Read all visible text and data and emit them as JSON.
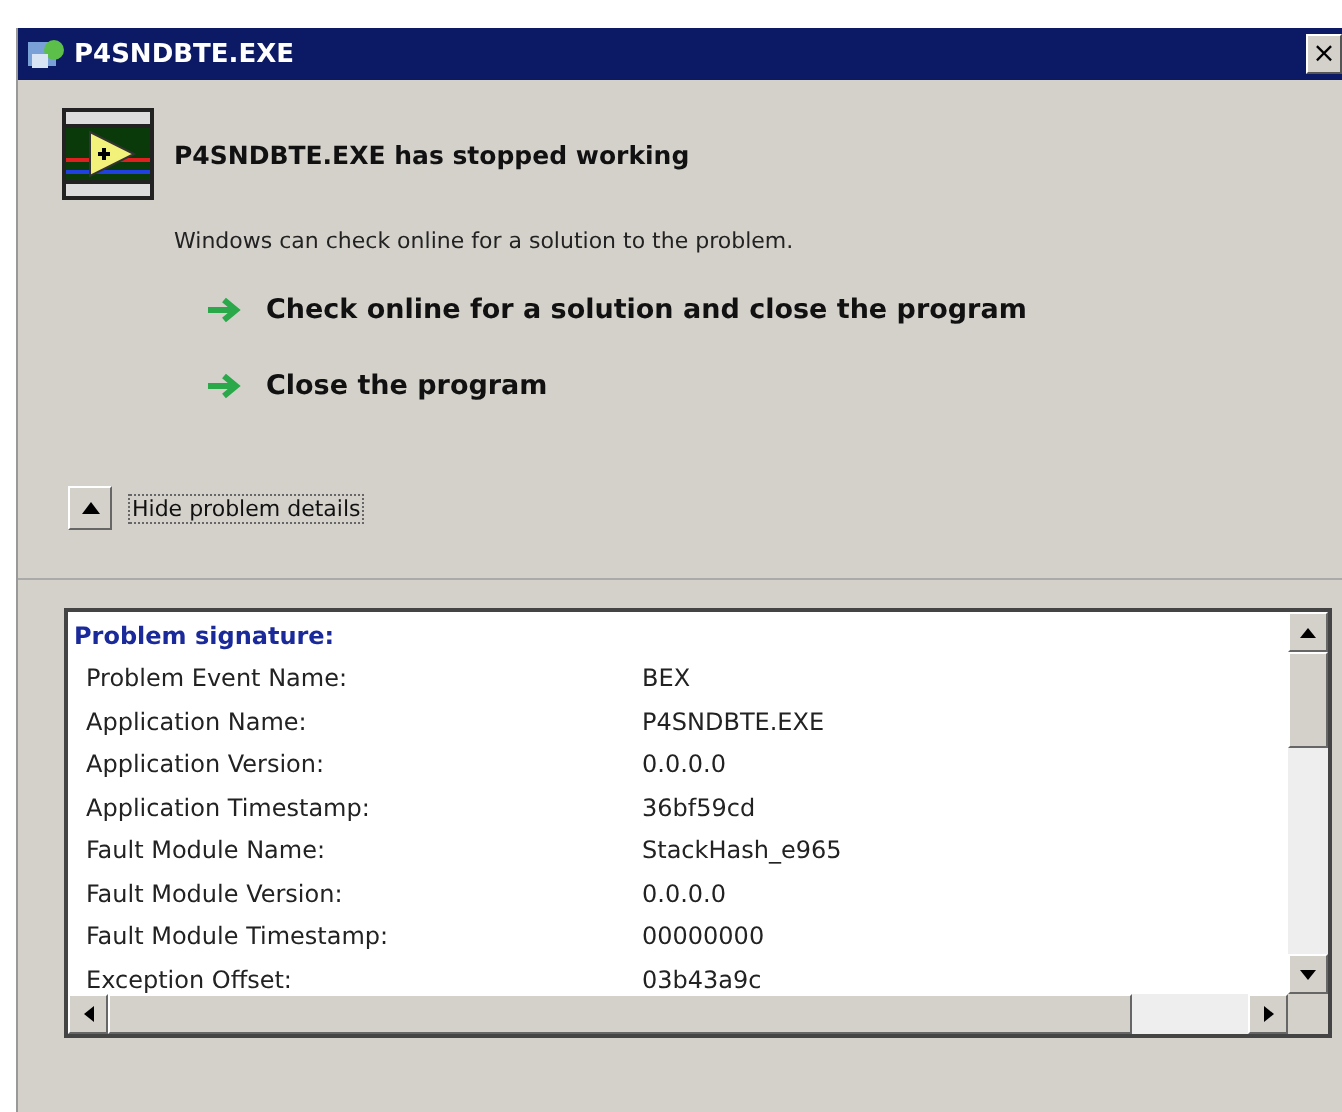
{
  "window": {
    "title": "P4SNDBTE.EXE",
    "close": "×"
  },
  "heading": "P4SNDBTE.EXE has stopped working",
  "message": "Windows can check online for a solution to the problem.",
  "actions": [
    {
      "label": "Check online for a solution and close the program"
    },
    {
      "label": "Close the program"
    }
  ],
  "details_toggle": {
    "label": "Hide problem details",
    "expanded": true
  },
  "details": {
    "title": "Problem signature:",
    "rows": [
      {
        "name": "Problem Event Name:",
        "value": "BEX"
      },
      {
        "name": "Application Name:",
        "value": "P4SNDBTE.EXE"
      },
      {
        "name": "Application Version:",
        "value": "0.0.0.0"
      },
      {
        "name": "Application Timestamp:",
        "value": "36bf59cd"
      },
      {
        "name": "Fault Module Name:",
        "value": "StackHash_e965"
      },
      {
        "name": "Fault Module Version:",
        "value": "0.0.0.0"
      },
      {
        "name": "Fault Module Timestamp:",
        "value": "00000000"
      },
      {
        "name": "Exception Offset:",
        "value": "03b43a9c"
      }
    ]
  }
}
